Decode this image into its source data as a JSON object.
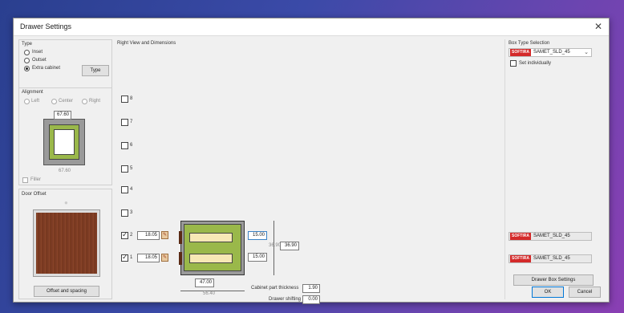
{
  "window": {
    "title": "Drawer Settings",
    "close_glyph": "✕"
  },
  "type_group": {
    "label": "Type",
    "options": [
      "Inset",
      "Outset",
      "Extra cabinet"
    ],
    "selected": "Extra cabinet",
    "type_button": "Type"
  },
  "alignment_group": {
    "label": "Alignment",
    "options": [
      "Left",
      "Center",
      "Right"
    ],
    "width_value": "67.60",
    "bottom_dim": "67.60",
    "filler_label": "Filler"
  },
  "door_offset": {
    "label": "Door Offset",
    "button": "Offset and spacing"
  },
  "right_view": {
    "label": "Right View and Dimensions",
    "rows": [
      {
        "num": "8",
        "checked": false
      },
      {
        "num": "7",
        "checked": false
      },
      {
        "num": "6",
        "checked": false
      },
      {
        "num": "5",
        "checked": false
      },
      {
        "num": "4",
        "checked": false
      },
      {
        "num": "3",
        "checked": false
      },
      {
        "num": "2",
        "checked": true,
        "value": "18.05"
      },
      {
        "num": "1",
        "checked": true,
        "value": "18.05"
      }
    ],
    "drawer_heights": [
      "15.00",
      "15.00"
    ],
    "height_a": "36.90",
    "height_b": "36.90",
    "inner_width": "47.00",
    "outer_width": "56.40",
    "cabinet_thickness_label": "Cabinet part thickness",
    "cabinet_thickness_value": "1.90",
    "drawer_shifting_label": "Drawer shifting",
    "drawer_shifting_value": "0.00"
  },
  "box_type": {
    "label": "Box Type Selection",
    "logo_text": "SOFTIRA",
    "selected": "SAMET_SLD_45",
    "set_individually": "Set individually",
    "list": [
      "SAMET_SLD_45",
      "SAMET_SLD_45"
    ],
    "drawer_box_button": "Drawer Box Settings"
  },
  "footer": {
    "ok": "OK",
    "cancel": "Cancel"
  },
  "colors": {
    "drawer_green": "#9ab84a",
    "drawer_fill": "#f7e8b5",
    "wood": "#7a3b22",
    "logo_red": "#d42a2a"
  }
}
